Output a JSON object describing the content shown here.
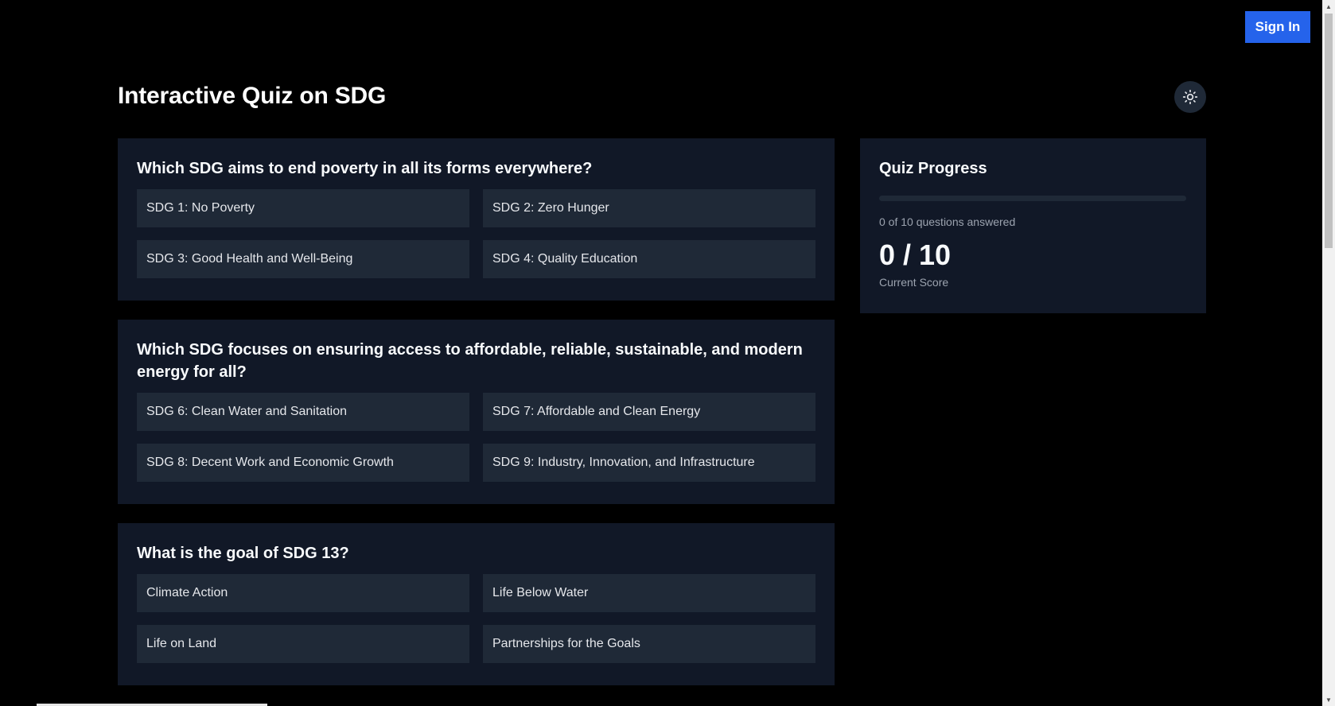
{
  "header": {
    "signin_label": "Sign In",
    "theme_icon": "sun-icon"
  },
  "page": {
    "title": "Interactive Quiz on SDG"
  },
  "questions": [
    {
      "text": "Which SDG aims to end poverty in all its forms everywhere?",
      "options": [
        "SDG 1: No Poverty",
        "SDG 2: Zero Hunger",
        "SDG 3: Good Health and Well-Being",
        "SDG 4: Quality Education"
      ]
    },
    {
      "text": "Which SDG focuses on ensuring access to affordable, reliable, sustainable, and modern energy for all?",
      "options": [
        "SDG 6: Clean Water and Sanitation",
        "SDG 7: Affordable and Clean Energy",
        "SDG 8: Decent Work and Economic Growth",
        "SDG 9: Industry, Innovation, and Infrastructure"
      ]
    },
    {
      "text": "What is the goal of SDG 13?",
      "options": [
        "Climate Action",
        "Life Below Water",
        "Life on Land",
        "Partnerships for the Goals"
      ]
    }
  ],
  "progress": {
    "title": "Quiz Progress",
    "fraction_complete": 0,
    "status": "0 of 10 questions answered",
    "score": "0 / 10",
    "score_label": "Current Score"
  },
  "colors": {
    "background": "#000000",
    "card": "#111827",
    "option": "#1f2937",
    "accent": "#2563eb"
  }
}
